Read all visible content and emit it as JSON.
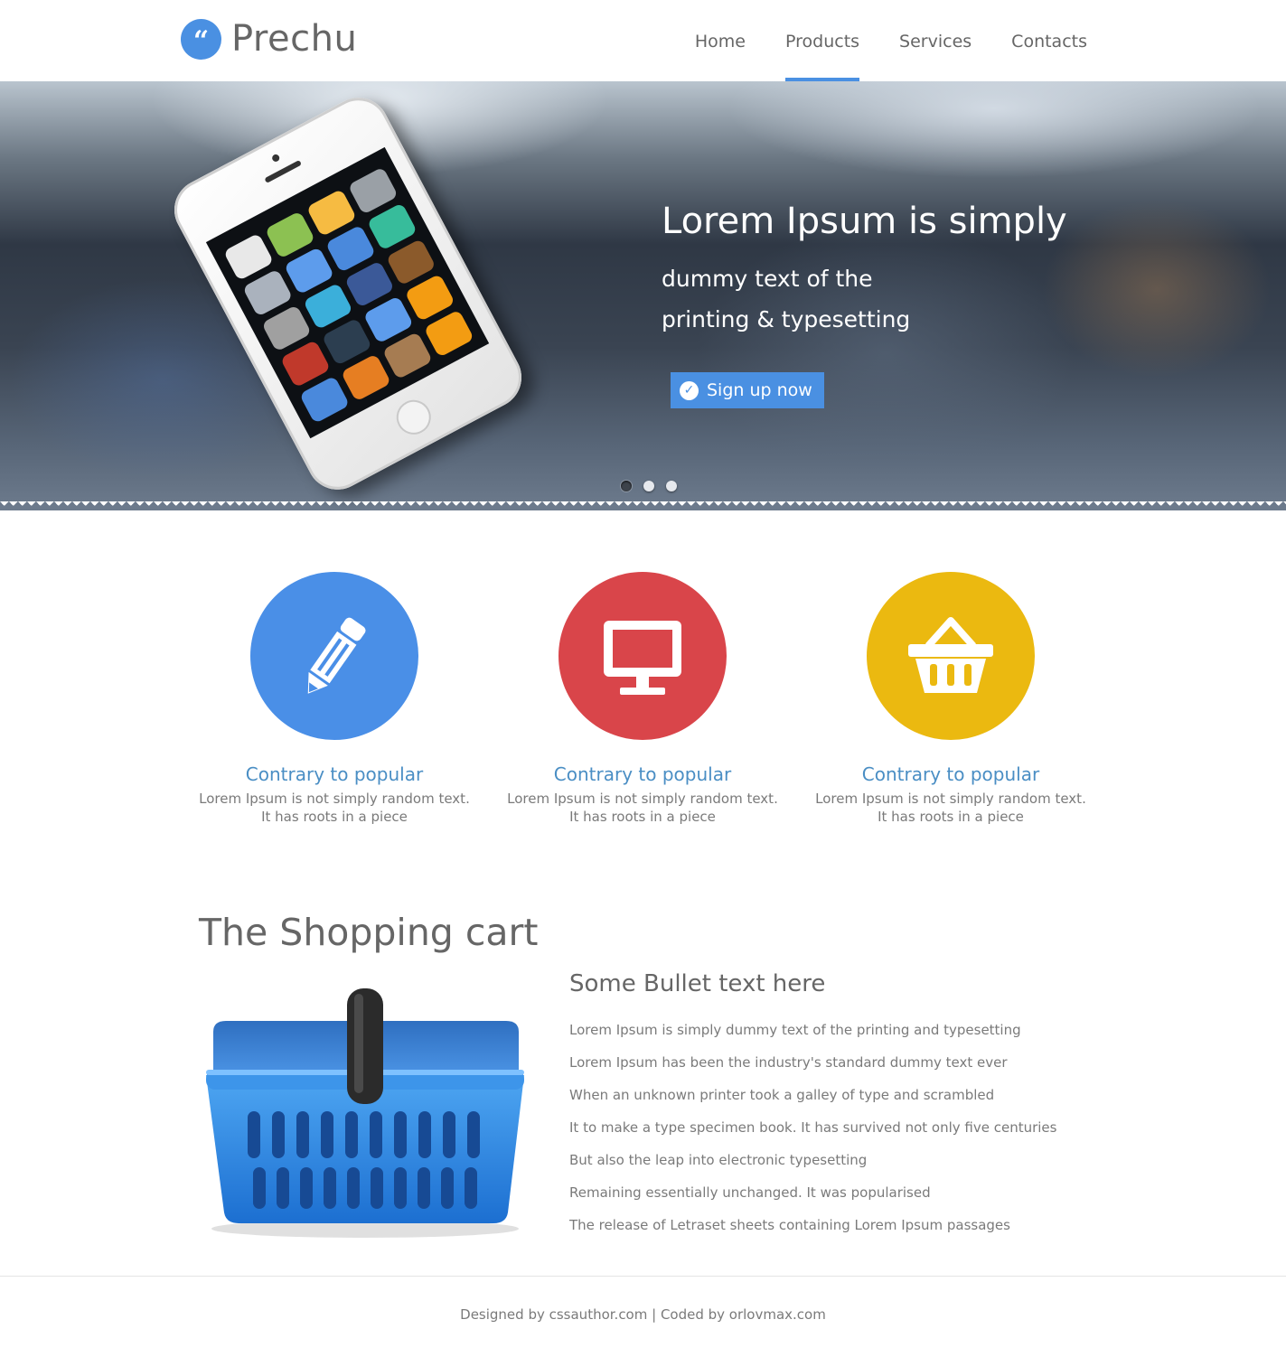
{
  "brand": {
    "logo_glyph": "“",
    "name": "Prechu",
    "accent_color": "#4a90e2"
  },
  "nav": {
    "items": [
      {
        "label": "Home",
        "active": false
      },
      {
        "label": "Products",
        "active": true
      },
      {
        "label": "Services",
        "active": false
      },
      {
        "label": "Contacts",
        "active": false
      }
    ]
  },
  "hero": {
    "title": "Lorem Ipsum is simply",
    "subtitle_line1": "dummy text of the",
    "subtitle_line2": "printing & typesetting",
    "cta_label": "Sign up now",
    "cta_icon": "check-circle-icon",
    "slides": 3,
    "active_slide": 1
  },
  "features": [
    {
      "icon": "pencil-icon",
      "color": "#4a8fe7",
      "title": "Contrary to popular",
      "line1": "Lorem Ipsum is not simply random text.",
      "line2": "It has roots in a piece"
    },
    {
      "icon": "monitor-icon",
      "color": "#d9454a",
      "title": "Contrary to popular",
      "line1": "Lorem Ipsum is not simply random text.",
      "line2": "It has roots in a piece"
    },
    {
      "icon": "basket-icon",
      "color": "#ebb910",
      "title": "Contrary to popular",
      "line1": "Lorem Ipsum is not simply random text.",
      "line2": "It has roots in a piece"
    }
  ],
  "cart_section": {
    "heading": "The Shopping cart",
    "bullets_title": "Some Bullet text here",
    "bullets": [
      "Lorem Ipsum is simply dummy text of the printing and typesetting",
      "Lorem Ipsum has been the industry's standard dummy text ever",
      "When an unknown printer took a galley of type and scrambled",
      "It to make a type specimen book. It has survived not only five centuries",
      "But also the leap into electronic typesetting",
      "Remaining essentially unchanged. It was popularised",
      "The release of Letraset sheets containing Lorem Ipsum passages"
    ]
  },
  "footer": {
    "text": "Designed by cssauthor.com | Coded by orlovmax.com"
  }
}
